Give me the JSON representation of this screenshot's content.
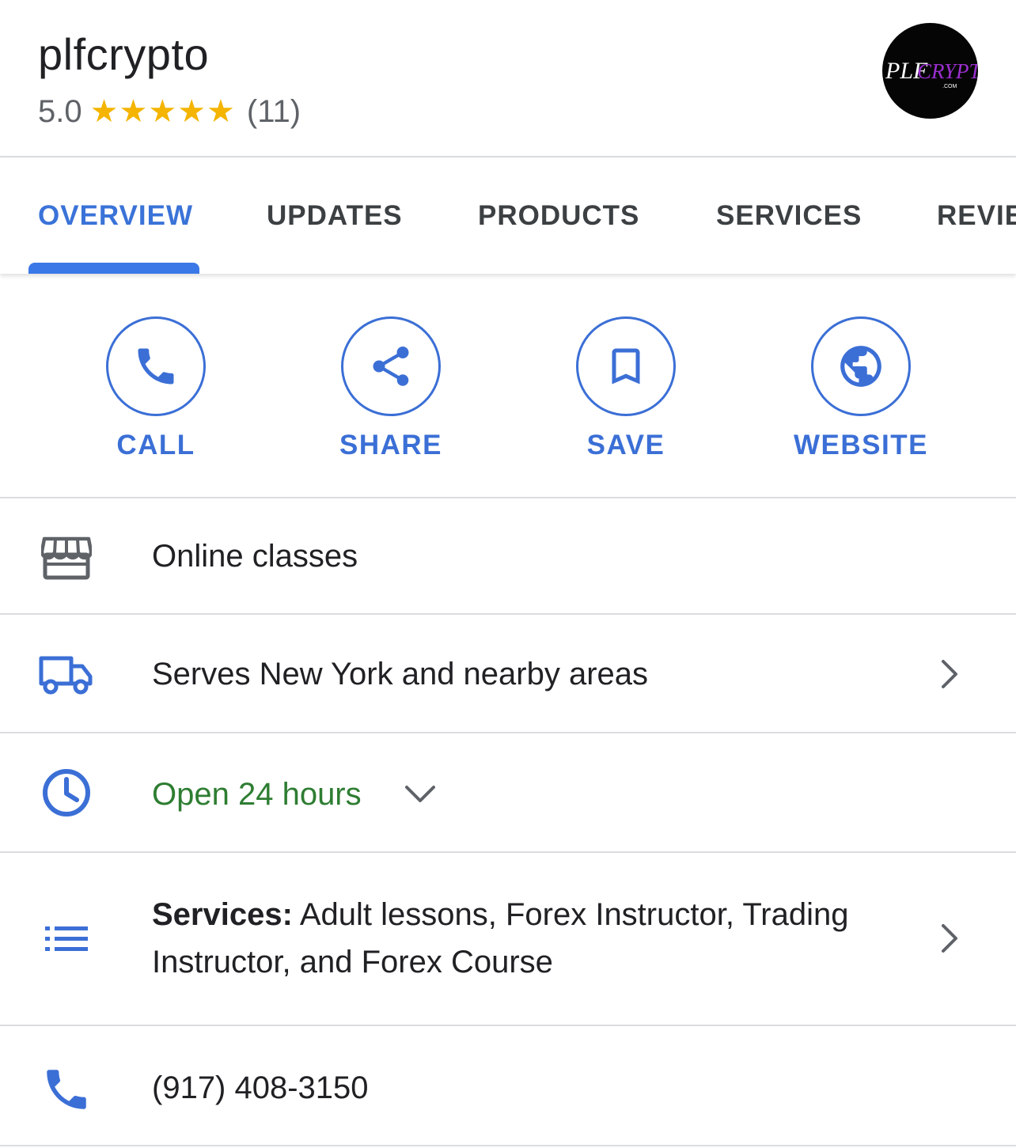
{
  "business": {
    "name": "plfcrypto",
    "rating": "5.0",
    "review_count": "(11)",
    "stars": 5,
    "logo_text": "PLFCRYPTO",
    "logo_subtext": ".COM"
  },
  "tabs": [
    {
      "label": "OVERVIEW",
      "active": true
    },
    {
      "label": "UPDATES",
      "active": false
    },
    {
      "label": "PRODUCTS",
      "active": false
    },
    {
      "label": "SERVICES",
      "active": false
    },
    {
      "label": "REVIEWS",
      "active": false
    }
  ],
  "actions": [
    {
      "label": "CALL",
      "icon": "phone-icon"
    },
    {
      "label": "SHARE",
      "icon": "share-icon"
    },
    {
      "label": "SAVE",
      "icon": "bookmark-icon"
    },
    {
      "label": "WEBSITE",
      "icon": "globe-icon"
    }
  ],
  "info": {
    "category": "Online classes",
    "service_area": "Serves New York and nearby areas",
    "hours": "Open 24 hours",
    "services_label": "Services:",
    "services_line1": " Adult lessons, Forex Instructor, Trading",
    "services_line2": "Instructor, and Forex Course",
    "phone": "(917) 408-3150"
  },
  "colors": {
    "accent": "#3b6fd6",
    "star": "#f4b400",
    "open_green": "#2e7d32",
    "divider": "#dadce0"
  }
}
